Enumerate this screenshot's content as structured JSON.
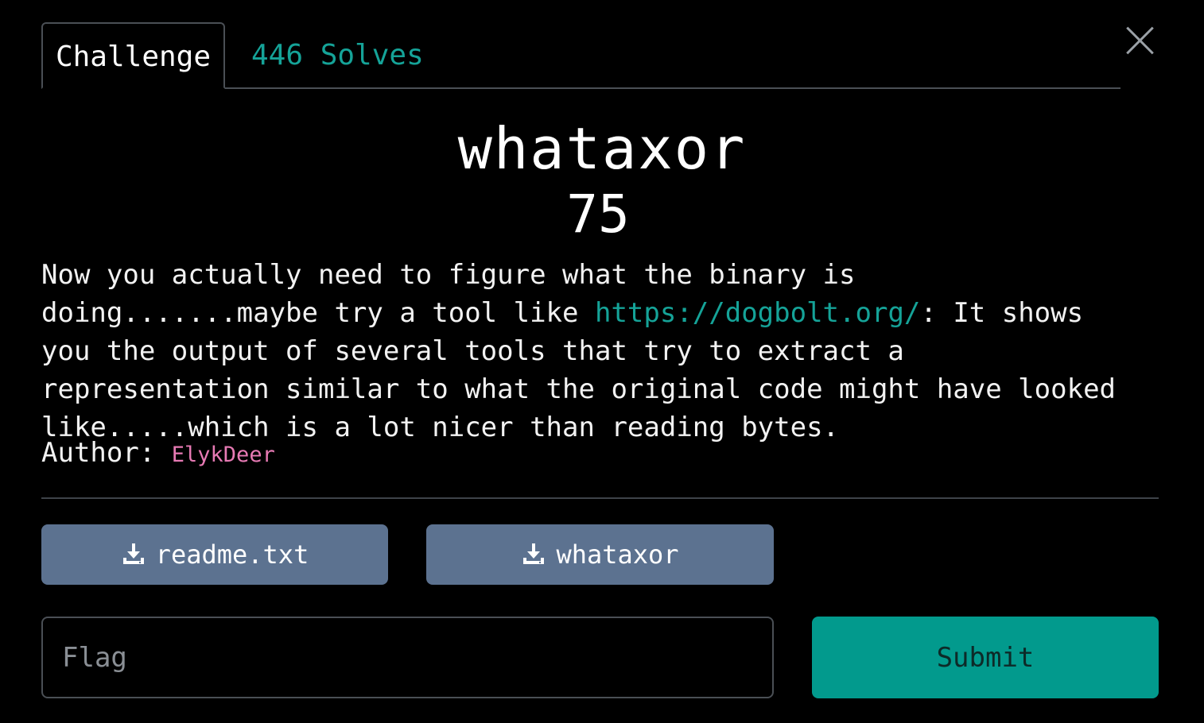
{
  "tabs": {
    "challenge_label": "Challenge",
    "solves_label": "446 Solves"
  },
  "challenge": {
    "name": "whataxor",
    "points": "75",
    "description_before_link": "Now you actually need to figure what the binary is doing.......maybe try a tool like ",
    "description_link": "https://dogbolt.org/",
    "description_after_link": ": It shows you the output of several tools that try to extract a representation similar to what the original code might have looked like.....which is a lot nicer than reading bytes.",
    "author_label": "Author:",
    "author_name": "ElykDeer"
  },
  "files": [
    {
      "label": "readme.txt",
      "icon": "download-icon"
    },
    {
      "label": "whataxor",
      "icon": "download-icon"
    }
  ],
  "form": {
    "flag_placeholder": "Flag",
    "submit_label": "Submit"
  },
  "colors": {
    "accent_teal": "#15a398",
    "submit_bg": "#029a8d",
    "file_button_bg": "#5c7290",
    "author_pink": "#e77ab4"
  }
}
